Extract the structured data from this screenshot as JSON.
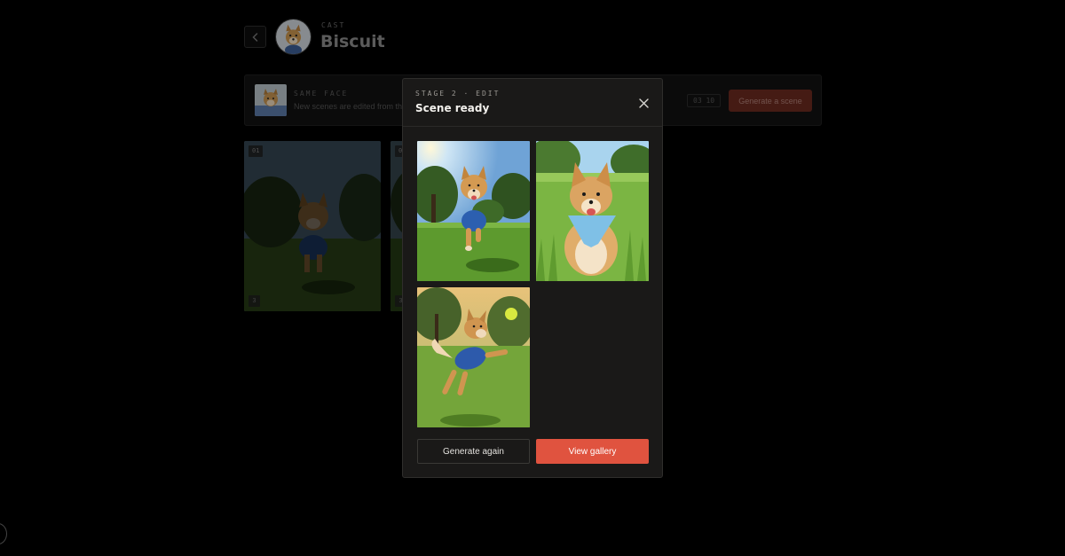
{
  "header": {
    "cast_label": "CAST",
    "pet_name": "Biscuit"
  },
  "face_bar": {
    "title": "SAME FACE",
    "subtitle": "New scenes are edited from th",
    "counter": "03 10",
    "generate_label": "Generate a scene"
  },
  "background_cards": [
    {
      "number": "01",
      "corner": "3"
    },
    {
      "number": "0",
      "corner": "3"
    }
  ],
  "modal": {
    "stage_label": "STAGE 2 · EDIT",
    "title": "Scene ready",
    "scenes": [
      {
        "icon": "dog-running-park-image"
      },
      {
        "icon": "dog-sitting-grass-image"
      },
      {
        "icon": "dog-jumping-ball-image"
      }
    ],
    "secondary_label": "Generate again",
    "primary_label": "View gallery"
  },
  "colors": {
    "accent": "#e0533f",
    "modal_bg": "#1a1918",
    "page_bg": "#000000"
  }
}
